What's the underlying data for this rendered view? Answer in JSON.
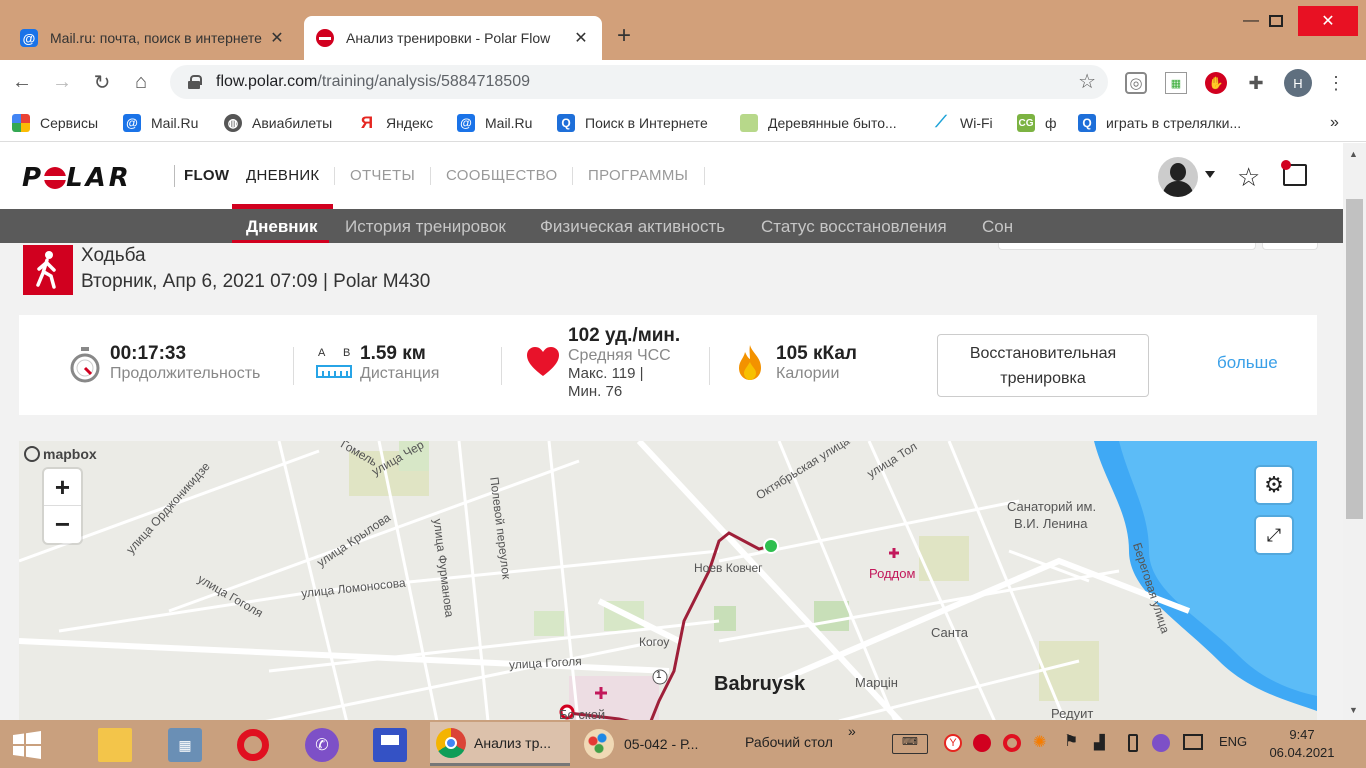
{
  "browser": {
    "tabs": [
      {
        "title": "Mail.ru: почта, поиск в интернете",
        "favicon": "mailru-at-icon",
        "active": false
      },
      {
        "title": "Анализ тренировки - Polar Flow",
        "favicon": "polar-icon",
        "active": true
      }
    ],
    "url": {
      "host": "flow.polar.com",
      "path": "/training/analysis/5884718509"
    },
    "profile_letter": "Н",
    "bookmarks": [
      {
        "label": "Сервисы",
        "icon": "apps-grid-icon"
      },
      {
        "label": "Mail.Ru",
        "icon": "mailru-at-icon"
      },
      {
        "label": "Авиабилеты",
        "icon": "globe-icon"
      },
      {
        "label": "Яндекс",
        "icon": "yandex-icon"
      },
      {
        "label": "Mail.Ru",
        "icon": "mailru-at-icon"
      },
      {
        "label": "Поиск в Интернете",
        "icon": "search-q-icon"
      },
      {
        "label": "Деревянные быто...",
        "icon": "page-icon"
      },
      {
        "label": "Wi-Fi",
        "icon": "wifi-site-icon"
      },
      {
        "label": "ф",
        "icon": "cg-icon"
      },
      {
        "label": "играть в стрелялки...",
        "icon": "search-q-icon"
      }
    ],
    "bookmarks_more": "»"
  },
  "polar": {
    "brand": "POLAR",
    "flow_label": "FLOW",
    "nav": [
      {
        "label": "ДНЕВНИК",
        "active": true
      },
      {
        "label": "ОТЧЕТЫ",
        "active": false
      },
      {
        "label": "СООБЩЕСТВО",
        "active": false
      },
      {
        "label": "ПРОГРАММЫ",
        "active": false
      }
    ],
    "subnav": [
      {
        "label": "Дневник",
        "active": true
      },
      {
        "label": "История тренировок",
        "active": false
      },
      {
        "label": "Физическая активность",
        "active": false
      },
      {
        "label": "Статус восстановления",
        "active": false
      },
      {
        "label": "Сон",
        "active": false
      }
    ]
  },
  "training": {
    "sport": "Ходьба",
    "date_device": "Вторник, Апр 6, 2021 07:09 | Polar M430",
    "duration": {
      "value": "00:17:33",
      "label": "Продолжительность"
    },
    "distance": {
      "value": "1.59 км",
      "label": "Дистанция",
      "ab_a": "A",
      "ab_b": "B"
    },
    "heart_rate": {
      "value": "102 уд./мин.",
      "label": "Средняя ЧСС",
      "max_line": "Макс. 119  |",
      "min_line": "Мин. 76"
    },
    "calories": {
      "value": "105 кКал",
      "label": "Калории"
    },
    "benefit_button": {
      "line1": "Восстановительная",
      "line2": "тренировка"
    },
    "more_link": "больше"
  },
  "map": {
    "attribution": "mapbox",
    "zoom_in": "+",
    "zoom_out": "−",
    "labels": {
      "ordzhonik": "улица Орджоникидзе",
      "gomel": "Гомель",
      "cher": "улица Чер",
      "krylova": "улица Крылова",
      "gogolya_left": "улица Гоголя",
      "lomonosova": "улица Ломоносова",
      "furmanova": "улица Фурманова",
      "polevoy": "Полевой переулок",
      "gogolya": "улица Гоголя",
      "oktyabrskaya": "Октябрьская улица",
      "tol": "улица Тол",
      "kovcheg": "Ноев Ковчег",
      "kogo": "Когоу",
      "roddom": "Роддом",
      "sanatoriy1": "Санаторий им.",
      "sanatoriy2": "В.И. Ленина",
      "santa": "Санта",
      "beregovaya": "Береговая улица",
      "babruysk": "Babruysk",
      "martsin": "Марцін",
      "redut": "Редуит",
      "bottom": "Бо           ской",
      "route_num": "1"
    }
  },
  "taskbar": {
    "tasks": [
      {
        "label": "Анализ тр...",
        "active": true
      },
      {
        "label": "05-042 - Р...",
        "active": false
      }
    ],
    "desktop_label": "Рабочий стол",
    "desktop_chevron": "»",
    "lang": "ENG",
    "time": "9:47",
    "date": "06.04.2021"
  }
}
